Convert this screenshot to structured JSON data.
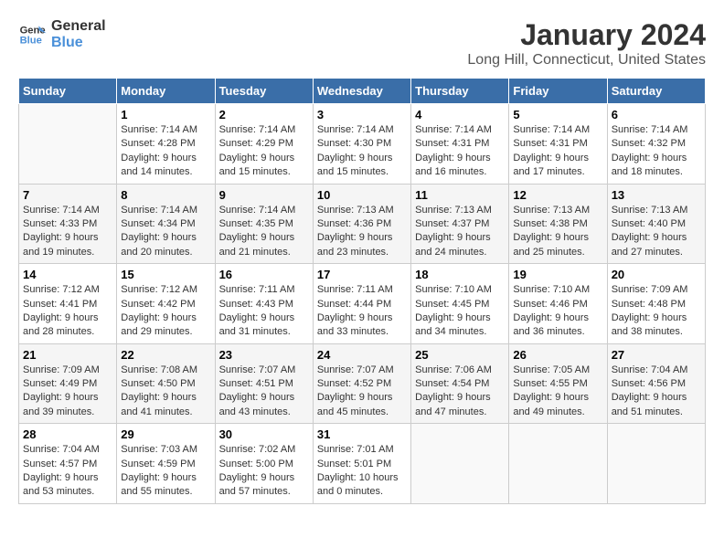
{
  "logo": {
    "line1": "General",
    "line2": "Blue"
  },
  "header": {
    "month": "January 2024",
    "location": "Long Hill, Connecticut, United States"
  },
  "weekdays": [
    "Sunday",
    "Monday",
    "Tuesday",
    "Wednesday",
    "Thursday",
    "Friday",
    "Saturday"
  ],
  "weeks": [
    [
      {
        "day": "",
        "info": ""
      },
      {
        "day": "1",
        "info": "Sunrise: 7:14 AM\nSunset: 4:28 PM\nDaylight: 9 hours\nand 14 minutes."
      },
      {
        "day": "2",
        "info": "Sunrise: 7:14 AM\nSunset: 4:29 PM\nDaylight: 9 hours\nand 15 minutes."
      },
      {
        "day": "3",
        "info": "Sunrise: 7:14 AM\nSunset: 4:30 PM\nDaylight: 9 hours\nand 15 minutes."
      },
      {
        "day": "4",
        "info": "Sunrise: 7:14 AM\nSunset: 4:31 PM\nDaylight: 9 hours\nand 16 minutes."
      },
      {
        "day": "5",
        "info": "Sunrise: 7:14 AM\nSunset: 4:31 PM\nDaylight: 9 hours\nand 17 minutes."
      },
      {
        "day": "6",
        "info": "Sunrise: 7:14 AM\nSunset: 4:32 PM\nDaylight: 9 hours\nand 18 minutes."
      }
    ],
    [
      {
        "day": "7",
        "info": "Sunrise: 7:14 AM\nSunset: 4:33 PM\nDaylight: 9 hours\nand 19 minutes."
      },
      {
        "day": "8",
        "info": "Sunrise: 7:14 AM\nSunset: 4:34 PM\nDaylight: 9 hours\nand 20 minutes."
      },
      {
        "day": "9",
        "info": "Sunrise: 7:14 AM\nSunset: 4:35 PM\nDaylight: 9 hours\nand 21 minutes."
      },
      {
        "day": "10",
        "info": "Sunrise: 7:13 AM\nSunset: 4:36 PM\nDaylight: 9 hours\nand 23 minutes."
      },
      {
        "day": "11",
        "info": "Sunrise: 7:13 AM\nSunset: 4:37 PM\nDaylight: 9 hours\nand 24 minutes."
      },
      {
        "day": "12",
        "info": "Sunrise: 7:13 AM\nSunset: 4:38 PM\nDaylight: 9 hours\nand 25 minutes."
      },
      {
        "day": "13",
        "info": "Sunrise: 7:13 AM\nSunset: 4:40 PM\nDaylight: 9 hours\nand 27 minutes."
      }
    ],
    [
      {
        "day": "14",
        "info": "Sunrise: 7:12 AM\nSunset: 4:41 PM\nDaylight: 9 hours\nand 28 minutes."
      },
      {
        "day": "15",
        "info": "Sunrise: 7:12 AM\nSunset: 4:42 PM\nDaylight: 9 hours\nand 29 minutes."
      },
      {
        "day": "16",
        "info": "Sunrise: 7:11 AM\nSunset: 4:43 PM\nDaylight: 9 hours\nand 31 minutes."
      },
      {
        "day": "17",
        "info": "Sunrise: 7:11 AM\nSunset: 4:44 PM\nDaylight: 9 hours\nand 33 minutes."
      },
      {
        "day": "18",
        "info": "Sunrise: 7:10 AM\nSunset: 4:45 PM\nDaylight: 9 hours\nand 34 minutes."
      },
      {
        "day": "19",
        "info": "Sunrise: 7:10 AM\nSunset: 4:46 PM\nDaylight: 9 hours\nand 36 minutes."
      },
      {
        "day": "20",
        "info": "Sunrise: 7:09 AM\nSunset: 4:48 PM\nDaylight: 9 hours\nand 38 minutes."
      }
    ],
    [
      {
        "day": "21",
        "info": "Sunrise: 7:09 AM\nSunset: 4:49 PM\nDaylight: 9 hours\nand 39 minutes."
      },
      {
        "day": "22",
        "info": "Sunrise: 7:08 AM\nSunset: 4:50 PM\nDaylight: 9 hours\nand 41 minutes."
      },
      {
        "day": "23",
        "info": "Sunrise: 7:07 AM\nSunset: 4:51 PM\nDaylight: 9 hours\nand 43 minutes."
      },
      {
        "day": "24",
        "info": "Sunrise: 7:07 AM\nSunset: 4:52 PM\nDaylight: 9 hours\nand 45 minutes."
      },
      {
        "day": "25",
        "info": "Sunrise: 7:06 AM\nSunset: 4:54 PM\nDaylight: 9 hours\nand 47 minutes."
      },
      {
        "day": "26",
        "info": "Sunrise: 7:05 AM\nSunset: 4:55 PM\nDaylight: 9 hours\nand 49 minutes."
      },
      {
        "day": "27",
        "info": "Sunrise: 7:04 AM\nSunset: 4:56 PM\nDaylight: 9 hours\nand 51 minutes."
      }
    ],
    [
      {
        "day": "28",
        "info": "Sunrise: 7:04 AM\nSunset: 4:57 PM\nDaylight: 9 hours\nand 53 minutes."
      },
      {
        "day": "29",
        "info": "Sunrise: 7:03 AM\nSunset: 4:59 PM\nDaylight: 9 hours\nand 55 minutes."
      },
      {
        "day": "30",
        "info": "Sunrise: 7:02 AM\nSunset: 5:00 PM\nDaylight: 9 hours\nand 57 minutes."
      },
      {
        "day": "31",
        "info": "Sunrise: 7:01 AM\nSunset: 5:01 PM\nDaylight: 10 hours\nand 0 minutes."
      },
      {
        "day": "",
        "info": ""
      },
      {
        "day": "",
        "info": ""
      },
      {
        "day": "",
        "info": ""
      }
    ]
  ]
}
